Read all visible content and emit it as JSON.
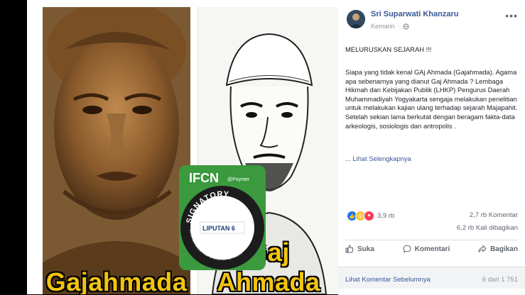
{
  "media": {
    "left_caption": "Gajahmada",
    "right_caption": "Gaj Ahmada",
    "badge": {
      "brand": "IFCN",
      "sub": "@Poynter",
      "word": "SIGNATORY",
      "network": "INTERNATIONAL FACT-CHECKING NETWORK",
      "member": "LIPUTAN 6"
    }
  },
  "post": {
    "author": "Sri Suparwati Khanzaru",
    "time": "Kemarin",
    "audience_icon": "globe-icon",
    "heading": "MELURUSKAN SEJARAH !!!",
    "body": "Siapa yang tidak kenal GAj Ahmada (Gajahmada). Agama apa sebenarnya yang dianut Gaj Ahmada ? Lembaga Hikmah dan Kebijakan Publik (LHKP) Pengurus Daerah Muhammadiyah Yogyakarta sengaja melakukan penelitian untuk melakukan kajian ulang terhadap sejarah Majapahit. Setelah sekian lama berkutat dengan beragam fakta-data arkeologis, sosiologis dan antropolis .",
    "see_more": "... Lihat Selengkapnya",
    "reaction_count": "3,9 rb",
    "comments": "2,7 rb Komentar",
    "shares": "6,2 rb Kali dibagikan",
    "actions": {
      "like": "Suka",
      "comment": "Komentari",
      "share": "Bagikan"
    },
    "prev_comments": "Lihat Komentar Sebelumnya",
    "pager": "6 dari 1.751"
  },
  "colors": {
    "link": "#385898",
    "caption": "#f1c40f",
    "badge_green": "#3a9a3d"
  }
}
